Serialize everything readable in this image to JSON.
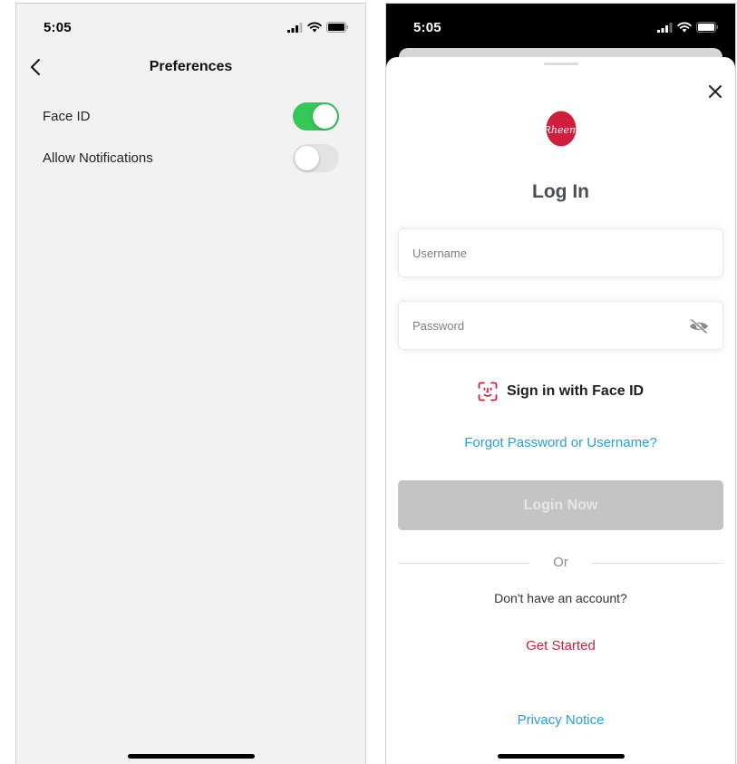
{
  "left_screen": {
    "status": {
      "time": "5:05"
    },
    "header": {
      "title": "Preferences"
    },
    "settings": [
      {
        "label": "Face ID",
        "enabled": true
      },
      {
        "label": "Allow Notifications",
        "enabled": false
      }
    ]
  },
  "right_screen": {
    "status": {
      "time": "5:05"
    },
    "logo": {
      "brand_text": "Rheem",
      "color": "#d01f3c"
    },
    "title": "Log In",
    "username": {
      "placeholder": "Username",
      "value": ""
    },
    "password": {
      "placeholder": "Password",
      "value": ""
    },
    "face_id_button": "Sign in with Face ID",
    "forgot_link": "Forgot Password or Username?",
    "login_button": "Login Now",
    "divider_text": "Or",
    "no_account_text": "Don't have an account?",
    "get_started_link": "Get Started",
    "privacy_link": "Privacy Notice"
  },
  "colors": {
    "toggle_on": "#34c759",
    "link_blue": "#2a9fd8",
    "brand_red": "#d01f3c",
    "button_disabled": "#c4c4c4"
  }
}
